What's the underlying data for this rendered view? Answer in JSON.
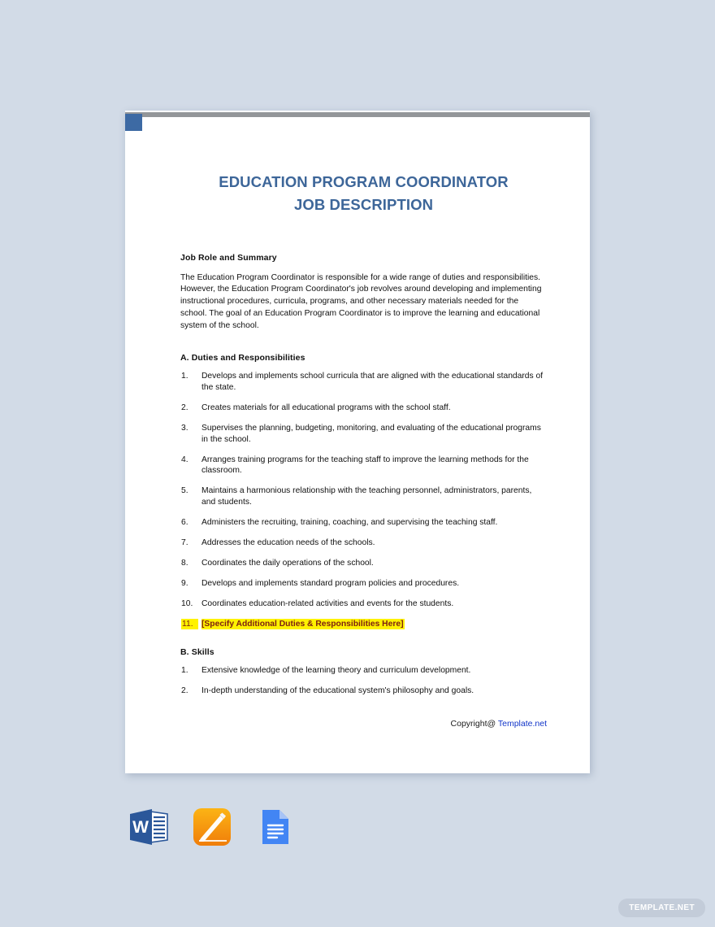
{
  "document": {
    "title_line1": "EDUCATION PROGRAM COORDINATOR",
    "title_line2": "JOB DESCRIPTION",
    "accent_color": "#3d6699",
    "header_bar_color": "#939699",
    "header_square_color": "#3d6aa4",
    "sections": {
      "role": {
        "heading": "Job Role and Summary",
        "paragraph": "The Education Program Coordinator is responsible for a wide range of duties and responsibilities. However, the Education Program Coordinator's job revolves around developing and implementing instructional procedures, curricula, programs, and other necessary materials needed for the school. The goal of an Education Program Coordinator is to improve the learning and educational system of the school."
      },
      "duties": {
        "heading": "A. Duties and Responsibilities",
        "items": [
          "Develops and implements school curricula that are aligned with the educational standards of the state.",
          "Creates materials for all educational programs with the school staff.",
          "Supervises the planning, budgeting, monitoring, and evaluating of the educational programs in the school.",
          "Arranges training programs for the teaching staff to improve the learning methods for the classroom.",
          "Maintains a harmonious relationship with the teaching personnel, administrators, parents, and students.",
          "Administers the recruiting, training, coaching, and supervising the teaching staff.",
          "Addresses the education needs of the schools.",
          "Coordinates the daily operations of the school.",
          "Develops and implements standard program policies and procedures.",
          "Coordinates education-related activities and events for the students."
        ],
        "highlighted_item": "[Specify Additional Duties & Responsibilities Here]",
        "highlight_bg": "#fff200",
        "highlight_fg": "#7b1f12"
      },
      "skills": {
        "heading": "B. Skills",
        "items": [
          "Extensive knowledge of the learning theory and curriculum development.",
          "In-depth understanding of the educational system's philosophy and goals."
        ]
      }
    },
    "footer": {
      "copyright_prefix": "Copyright@ ",
      "copyright_link": "Template.net",
      "link_color": "#1034c8"
    }
  },
  "format_icons": [
    {
      "name": "microsoft-word-icon",
      "label": "W",
      "color": "#2b579a"
    },
    {
      "name": "apple-pages-icon",
      "label": "",
      "color": "#f59a12"
    },
    {
      "name": "google-docs-icon",
      "label": "",
      "color": "#4285f4"
    }
  ],
  "watermark": {
    "label": "TEMPLATE.NET",
    "bg": "#c3ccd9",
    "fg": "#ffffff"
  }
}
